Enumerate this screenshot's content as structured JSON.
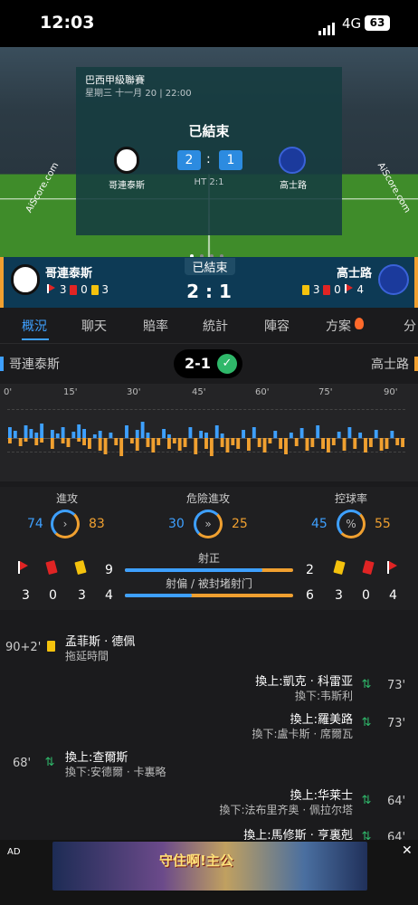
{
  "status_bar": {
    "time": "12:03",
    "network": "4G",
    "battery": "63"
  },
  "hero": {
    "league": "巴西甲級聯賽",
    "date": "星期三 十一月 20 | 22:00",
    "status": "已結束",
    "home_score": "2",
    "away_score": "1",
    "colon": ":",
    "home_team": "哥連泰斯",
    "away_team": "高士路",
    "half_time": "HT 2:1",
    "brand_left": "AiScore.com",
    "brand_right": "AiScore.com"
  },
  "scorebar": {
    "status": "已結束",
    "score": "2 : 1",
    "home_team": "哥連泰斯",
    "away_team": "高士路",
    "home_corners": "3",
    "home_red": "0",
    "home_yellow": "3",
    "away_yellow": "3",
    "away_red": "0",
    "away_corners": "4"
  },
  "tabs": [
    {
      "label": "概況",
      "active": true
    },
    {
      "label": "聊天"
    },
    {
      "label": "賠率"
    },
    {
      "label": "統計"
    },
    {
      "label": "陣容"
    },
    {
      "label": "方案"
    },
    {
      "label": "分"
    }
  ],
  "result": {
    "home_team": "哥連泰斯",
    "away_team": "高士路",
    "score": "2-1",
    "check": "✓"
  },
  "momentum": {
    "ticks": [
      "0'",
      "15'",
      "30'",
      "45'",
      "60'",
      "75'",
      "90'"
    ],
    "home_color": "#3ea0ff",
    "away_color": "#f0a030"
  },
  "stats": {
    "attack": {
      "label": "進攻",
      "home": "74",
      "away": "83"
    },
    "dangerous": {
      "label": "危險進攻",
      "home": "30",
      "away": "25"
    },
    "possession": {
      "label": "控球率",
      "home": "45",
      "away": "55",
      "symbol": "%"
    },
    "shots_on": {
      "label": "射正",
      "home": "9",
      "away": "2"
    },
    "shots_off": {
      "label": "射偏 / 被封堵射门",
      "home": "4",
      "away": "6"
    },
    "home_corners": "3",
    "home_red": "0",
    "home_yellow": "3",
    "away_yellow": "3",
    "away_red": "0",
    "away_corners": "4"
  },
  "events": [
    {
      "time": "90+2'",
      "main": "孟菲斯 · 德佩",
      "sub": "拖延時間"
    },
    {
      "time": "73'",
      "main": "換上:凱克 · 科雷亚",
      "sub": "換下:韦斯利"
    },
    {
      "time": "73'",
      "main": "換上:羅美路",
      "sub": "換下:盧卡斯 · 席爾瓦"
    },
    {
      "time": "68'",
      "main": "換上:查爾斯",
      "sub": "換下:安德爾 · 卡裏略"
    },
    {
      "time": "64'",
      "main": "換上:华莱士",
      "sub": "換下:法布里齐奥 · 佩拉尔塔"
    },
    {
      "time": "64'",
      "main": "換上:馬修斯 · 亨裏剋",
      "sub": ""
    }
  ],
  "ad": {
    "label": "AD",
    "close": "✕",
    "text": "守住啊!主公"
  }
}
